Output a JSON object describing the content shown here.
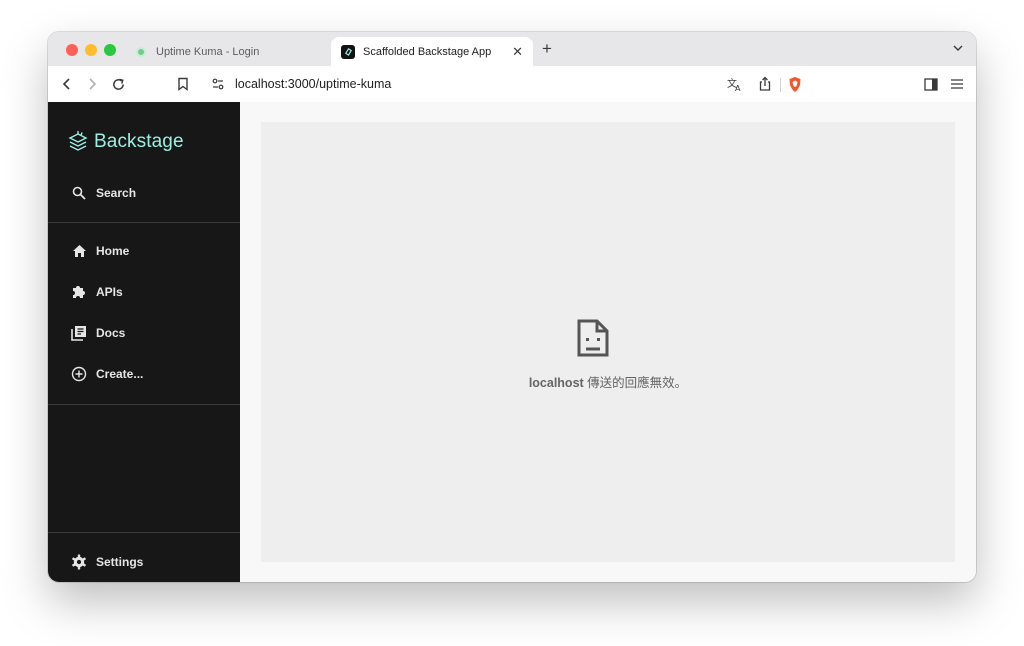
{
  "browser": {
    "tabs": [
      {
        "title": "Uptime Kuma - Login",
        "active": false
      },
      {
        "title": "Scaffolded Backstage App",
        "active": true
      }
    ],
    "url": "localhost:3000/uptime-kuma"
  },
  "sidebar": {
    "logo_text": "Backstage",
    "search_label": "Search",
    "items": [
      {
        "label": "Home",
        "icon": "home-icon"
      },
      {
        "label": "APIs",
        "icon": "puzzle-icon"
      },
      {
        "label": "Docs",
        "icon": "library-icon"
      },
      {
        "label": "Create...",
        "icon": "add-circle-icon"
      }
    ],
    "settings_label": "Settings"
  },
  "error": {
    "host": "localhost",
    "message": " 傳送的回應無效。"
  },
  "colors": {
    "sidebar_bg": "#171717",
    "logo_accent": "#9bf0e1",
    "panel_bg": "#eeeeee"
  }
}
